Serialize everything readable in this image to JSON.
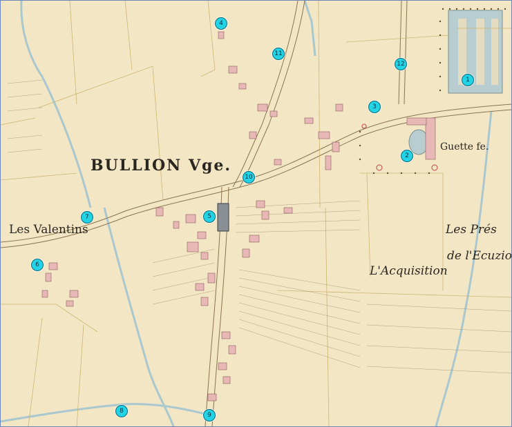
{
  "labels": {
    "village": "BULLION Vge.",
    "hamlet": "Les Valentins",
    "farm": "Guette fe.",
    "field_1": "Les Prés",
    "field_2": "de l'Ecuzio",
    "field_3": "L'Acquisition"
  },
  "markers": [
    {
      "id": 1,
      "label": "1"
    },
    {
      "id": 2,
      "label": "2"
    },
    {
      "id": 3,
      "label": "3"
    },
    {
      "id": 4,
      "label": "4"
    },
    {
      "id": 5,
      "label": "5"
    },
    {
      "id": 6,
      "label": "6"
    },
    {
      "id": 7,
      "label": "7"
    },
    {
      "id": 8,
      "label": "8"
    },
    {
      "id": 9,
      "label": "9"
    },
    {
      "id": 10,
      "label": "10"
    },
    {
      "id": 11,
      "label": "11"
    },
    {
      "id": 12,
      "label": "12"
    }
  ],
  "colors": {
    "paper": "#f2e6c4",
    "water": "#a9c7cf",
    "building": "#e8b8b6",
    "marker": "#22d3e6",
    "ink": "#6f5a3c"
  }
}
